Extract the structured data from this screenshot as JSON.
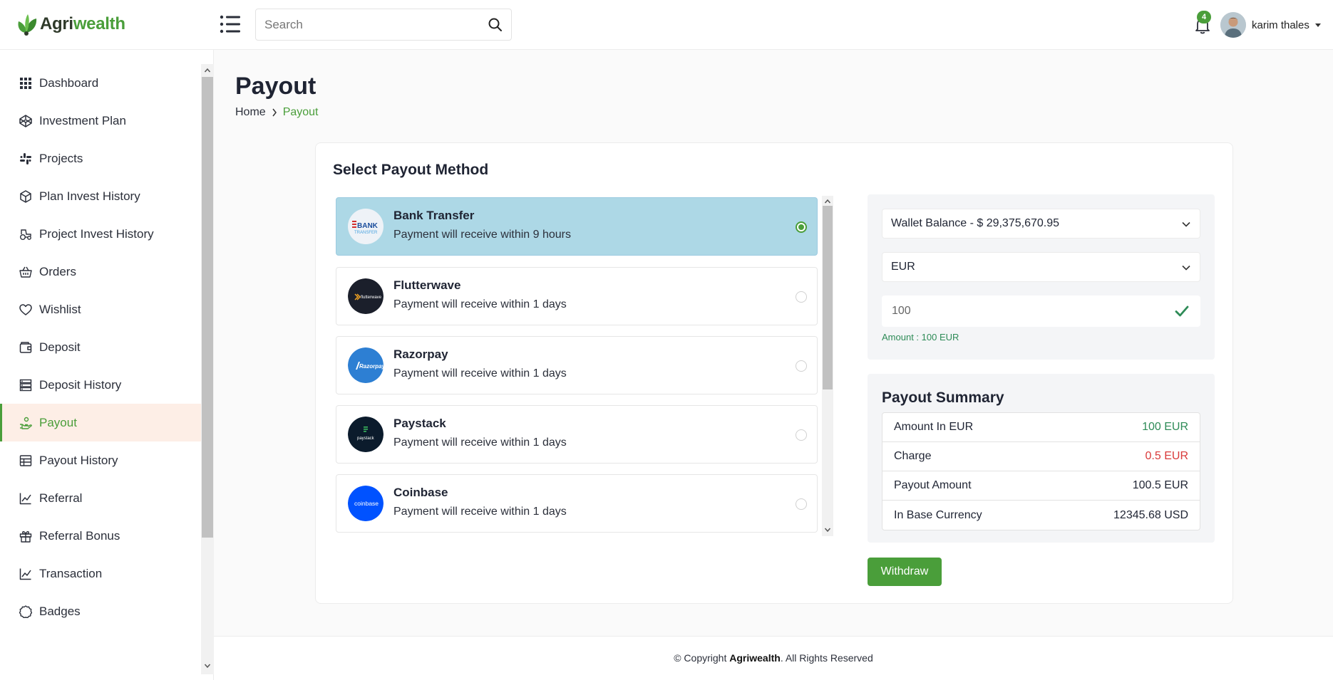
{
  "header": {
    "logo_part1": "Agri",
    "logo_part2": "wealth",
    "search_placeholder": "Search",
    "notifications_count": "4",
    "user_name": "karim thales"
  },
  "sidebar": {
    "items": [
      {
        "label": "Dashboard",
        "icon": "grid-icon"
      },
      {
        "label": "Investment Plan",
        "icon": "codepen-icon"
      },
      {
        "label": "Projects",
        "icon": "slack-icon"
      },
      {
        "label": "Plan Invest History",
        "icon": "box-icon"
      },
      {
        "label": "Project Invest History",
        "icon": "tractor-icon"
      },
      {
        "label": "Orders",
        "icon": "basket-icon"
      },
      {
        "label": "Wishlist",
        "icon": "heart-icon"
      },
      {
        "label": "Deposit",
        "icon": "wallet-icon"
      },
      {
        "label": "Deposit History",
        "icon": "server-icon"
      },
      {
        "label": "Payout",
        "icon": "hand-coin-icon",
        "active": true
      },
      {
        "label": "Payout History",
        "icon": "table-icon"
      },
      {
        "label": "Referral",
        "icon": "chart-line-icon"
      },
      {
        "label": "Referral Bonus",
        "icon": "gift-icon"
      },
      {
        "label": "Transaction",
        "icon": "chart-line-icon"
      },
      {
        "label": "Badges",
        "icon": "badge-icon"
      }
    ]
  },
  "page": {
    "title": "Payout",
    "breadcrumb_home": "Home",
    "breadcrumb_current": "Payout"
  },
  "payout": {
    "section_title": "Select Payout Method",
    "methods": [
      {
        "name": "Bank Transfer",
        "desc": "Payment will receive within 9 hours",
        "selected": true,
        "logo_color": "#e8eef5",
        "logo_text": "BANK"
      },
      {
        "name": "Flutterwave",
        "desc": "Payment will receive within 1 days",
        "selected": false,
        "logo_color": "#1b1f2b",
        "logo_text": "flutterwave"
      },
      {
        "name": "Razorpay",
        "desc": "Payment will receive within 1 days",
        "selected": false,
        "logo_color": "#2d7fd3",
        "logo_text": "Razorpay"
      },
      {
        "name": "Paystack",
        "desc": "Payment will receive within 1 days",
        "selected": false,
        "logo_color": "#0b1b2c",
        "logo_text": "paystack"
      },
      {
        "name": "Coinbase",
        "desc": "Payment will receive within 1 days",
        "selected": false,
        "logo_color": "#0052ff",
        "logo_text": "coinbase"
      }
    ],
    "wallet_select": "Wallet Balance - $ 29,375,670.95",
    "currency_select": "EUR",
    "amount_value": "100",
    "amount_note": "Amount : 100 EUR",
    "summary_title": "Payout Summary",
    "summary_rows": [
      {
        "label": "Amount In EUR",
        "value": "100 EUR",
        "tone": "green"
      },
      {
        "label": "Charge",
        "value": "0.5 EUR",
        "tone": "red"
      },
      {
        "label": "Payout Amount",
        "value": "100.5 EUR",
        "tone": ""
      },
      {
        "label": "In Base Currency",
        "value": "12345.68 USD",
        "tone": ""
      }
    ],
    "withdraw_label": "Withdraw"
  },
  "footer": {
    "prefix": "© Copyright ",
    "brand": "Agriwealth",
    "suffix": ". All Rights Reserved"
  },
  "colors": {
    "brand_green": "#4a9e3a",
    "selected_method_bg": "#add8e6",
    "active_nav_bg": "#fdeee6"
  }
}
